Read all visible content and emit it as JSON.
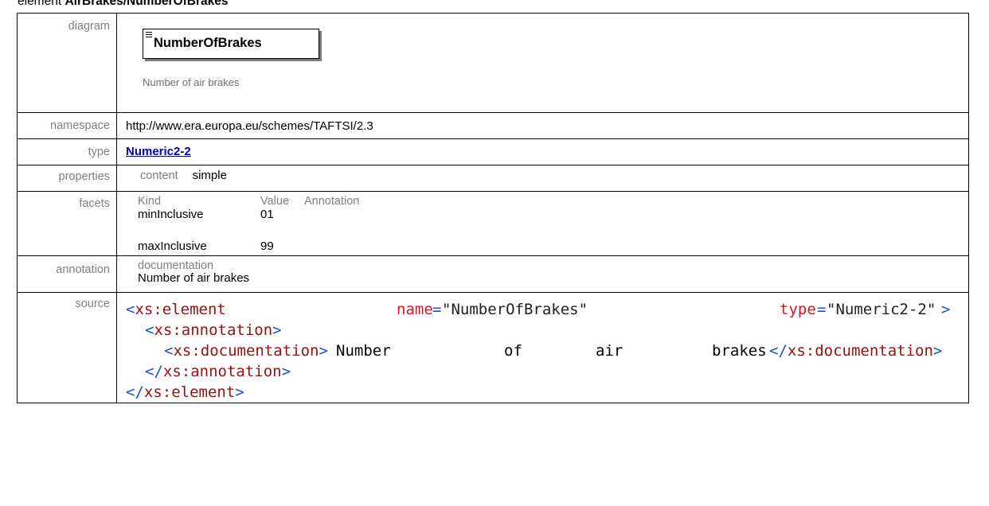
{
  "title": {
    "prefix": "element",
    "name": "AirBrakes/NumberOfBrakes"
  },
  "labels": {
    "diagram": "diagram",
    "namespace": "namespace",
    "type": "type",
    "properties": "properties",
    "facets": "facets",
    "annotation": "annotation",
    "source": "source"
  },
  "diagram": {
    "element_name": "NumberOfBrakes",
    "documentation": "Number of air brakes",
    "icon": "element-list-icon"
  },
  "namespace": "http://www.era.europa.eu/schemes/TAFTSI/2.3",
  "type": "Numeric2-2",
  "properties": {
    "key": "content",
    "value": "simple"
  },
  "facets": {
    "headers": [
      "Kind",
      "Value",
      "Annotation"
    ],
    "rows": [
      {
        "kind": "minInclusive",
        "value": "01",
        "annotation": ""
      },
      {
        "kind": "maxInclusive",
        "value": "99",
        "annotation": ""
      }
    ]
  },
  "annotation": {
    "key": "documentation",
    "value": "Number of air brakes"
  },
  "source": {
    "l1_open": "<xs:element",
    "l1_attr1": "name",
    "l1_val1": "\"NumberOfBrakes\"",
    "l1_attr2": "type",
    "l1_val2": "\"Numeric2-2\"",
    "l1_close": ">",
    "l2": "<xs:annotation>",
    "l3_open": "<xs:documentation>",
    "l3_w1": "Number",
    "l3_w2": "of",
    "l3_w3": "air",
    "l3_w4": "brakes",
    "l3_close": "</xs:documentation>",
    "l4": "</xs:annotation>",
    "l5": "</xs:element>"
  },
  "colors": {
    "label_gray": "#7f7f7f",
    "link": "#0000cc",
    "xml_bracket": "#1b4fd1",
    "xml_tag": "#9a1010",
    "xml_attr": "#e0141f"
  }
}
